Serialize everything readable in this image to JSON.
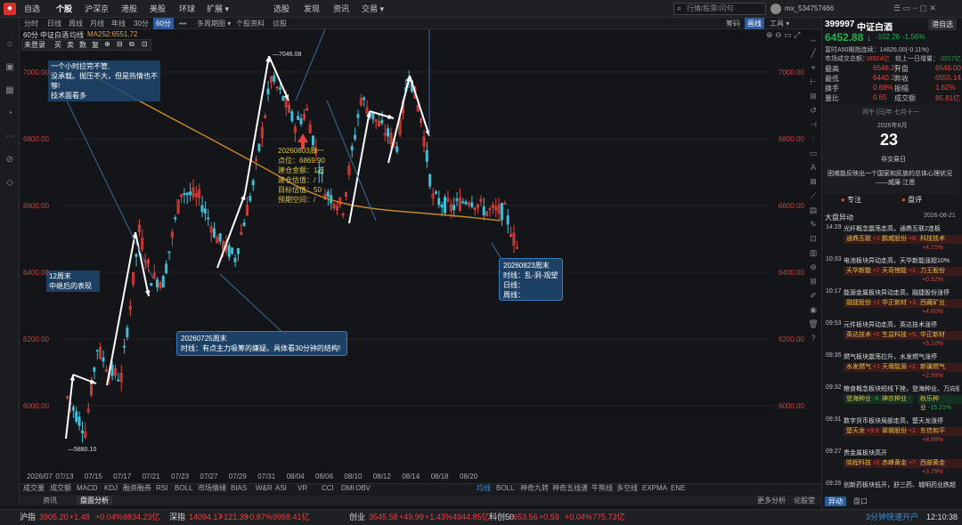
{
  "topbar": {
    "nav": [
      "自选",
      "个股",
      "沪深京",
      "港股",
      "美股",
      "环球",
      "扩展 ▾",
      "选股",
      "发现",
      "资讯",
      "交易 ▾"
    ],
    "active": 1,
    "search_placeholder": "行情/股票/问句",
    "user": "mx_534757466"
  },
  "periodbar": {
    "tabs": [
      "分时",
      "日线",
      "周线",
      "月线",
      "年线",
      "30分",
      "60分",
      "•••",
      "多周期图 ▾",
      "个股资料",
      "诊股"
    ],
    "active": 6,
    "right": [
      "筹码",
      "画线",
      "工具 ▾"
    ]
  },
  "chart": {
    "label": "60分",
    "name": "中证白酒",
    "ma_label": "均线",
    "ma_value": "MA252:6551.72",
    "toolbar": [
      "买",
      "卖",
      "数",
      "复",
      "⊕",
      "⊟",
      "⧉",
      "⊡"
    ],
    "toolbar_first": "未登录",
    "ylabels": [
      "7000.00",
      "6800.00",
      "6600.00",
      "6400.00",
      "6200.00",
      "6000.00"
    ],
    "xlabels": [
      "2026/07",
      "07/13",
      "07/15",
      "07/17",
      "07/21",
      "07/23",
      "07/27",
      "07/29",
      "07/31",
      "08/04",
      "08/06",
      "08/10",
      "08/12",
      "08/14",
      "08/18",
      "08/20"
    ],
    "high_label": "—7046.08",
    "low_label": "—5880.10",
    "notes": {
      "tl1": "一个小时拉完不管,",
      "tl2": "没承载。抛压不大，但是热情也不够!",
      "tl3": "技术面看多",
      "ml1": "12周末",
      "ml2": "中继后的表现",
      "buy1": "20260803周一",
      "buy2": "点位：6869.90",
      "buy3": "建仓金额：1万",
      "buy4": "建仓估值：/",
      "buy5": "目标估值：50",
      "buy6": "预期空间：/",
      "w1": "20260725周末",
      "w2": "时线：有点主力吸筹的嫌疑。具体看30分钟的结构!",
      "r1": "20260823周末",
      "r2": "时线：乱-洞-观望",
      "r3": "日线：",
      "r4": "周线："
    }
  },
  "indicators": {
    "left": [
      "成交量",
      "成交额",
      "MACD",
      "KDJ",
      "融资融券",
      "RSI",
      "BOLL",
      "市场情绪",
      "BIAS",
      "W&R",
      "ASI",
      "VR",
      "CCI",
      "DMI",
      "OBV"
    ],
    "right": [
      "均线",
      "BOLL",
      "神奇九转",
      "神奇五线谱",
      "牛熊线",
      "多空线",
      "EXPMA",
      "ENE"
    ]
  },
  "infobar": {
    "tabs": [
      "资讯",
      "盘面分析"
    ],
    "right": [
      "更多分析",
      "论股堂"
    ]
  },
  "right_panel": {
    "code": "399997",
    "name": "中证白酒",
    "btn": "港自选",
    "price": "6452.88 ↓",
    "chg": "-102.26",
    "pct": "-1.56%",
    "sub1": "富时A50期指连续：14826.00(-0.11%)",
    "sub2a": "市场成交总额：",
    "sub2b": "18924亿",
    "sub2c": "较上一日增量：",
    "sub2d": "-2017亿",
    "stats": [
      [
        "最高",
        "6546.25",
        "开盘",
        "6546.00"
      ],
      [
        "最低",
        "6440.21",
        "昨收",
        "6555.14"
      ],
      [
        "换手",
        "0.68%",
        "振幅",
        "1.62%"
      ],
      [
        "量比",
        "0.65",
        "成交额",
        "85.81亿"
      ]
    ],
    "cal_top": "丙午 [马]年 七月十一",
    "cal_month": "2026年8月",
    "cal_day": "23",
    "cal_note": "非交易日",
    "quote1": "困难能反映出一个国家和民族的总体心理状况",
    "quote2": "——威廉·江恩",
    "btn1": "专注",
    "btn2": "盘评",
    "news_title": "大盘异动",
    "news_date": "2026-08-21",
    "news": [
      {
        "t": "14:29",
        "h": "光纤概念震荡走高，通鼎互联2连板",
        "tags": [
          [
            "通鼎互联",
            "+10.02%",
            "r"
          ],
          [
            "鹏威股份",
            "+8.42%",
            "r"
          ],
          [
            "科技技术",
            "+4.15%",
            "r"
          ]
        ]
      },
      {
        "t": "10:33",
        "h": "电池板块异动走高，天华新能涨超10%",
        "tags": [
          [
            "天华新能",
            "+7.88%",
            "r"
          ],
          [
            "天奇锂能",
            "+1.57%",
            "r"
          ],
          [
            "力王股份",
            "+0.52%",
            "r"
          ]
        ]
      },
      {
        "t": "10:17",
        "h": "能源金属板块异动走高，融捷股份涨停",
        "tags": [
          [
            "融捷股份",
            "+10.00%",
            "r"
          ],
          [
            "华正新材",
            "+3.90%",
            "r"
          ],
          [
            "西藏矿业",
            "+4.60%",
            "r"
          ]
        ]
      },
      {
        "t": "09:53",
        "h": "元件板块异动走高，英达技术涨停",
        "tags": [
          [
            "英达技术",
            "+6.88%",
            "r"
          ],
          [
            "生益科技",
            "+5.16%",
            "r"
          ],
          [
            "华正新材",
            "+5.10%",
            "r"
          ]
        ]
      },
      {
        "t": "09:35",
        "h": "燃气板块震荡拉升，水发燃气涨停",
        "tags": [
          [
            "水发燃气",
            "+10.03%",
            "r"
          ],
          [
            "天壕能源",
            "+2.25%",
            "r"
          ],
          [
            "新疆燃气",
            "+2.99%",
            "r"
          ]
        ]
      },
      {
        "t": "09:32",
        "h": "粮食概念板块短线下挫，登海种业、万向德农跌",
        "tags": [
          [
            "登海种业",
            "-9.04%",
            "g"
          ],
          [
            "神农种业",
            "-",
            "g"
          ],
          [
            "秋乐种业",
            "-15.21%",
            "g"
          ]
        ]
      },
      {
        "t": "09:31",
        "h": "数字货币板块局部走高，楚天龙涨停",
        "tags": [
          [
            "楚天龙",
            "+9.97%",
            "r"
          ],
          [
            "翠微股份",
            "+2.49%",
            "r"
          ],
          [
            "东信和平",
            "+8.99%",
            "r"
          ]
        ]
      },
      {
        "t": "09:27",
        "h": "贵金属板块高开",
        "tags": [
          [
            "晓程科技",
            "+8.55%",
            "r"
          ],
          [
            "赤峰黄金",
            "+7.22%",
            "r"
          ],
          [
            "西部黄金",
            "+3.79%",
            "r"
          ]
        ]
      },
      {
        "t": "09:26",
        "h": "创新药板块低开，舒三药、城明药业跌超",
        "tags": []
      }
    ],
    "tabs": [
      "异动",
      "盘口"
    ],
    "timer": "3分钟快速开户",
    "clock": "12:10:38"
  },
  "ticker": [
    {
      "name": "沪指",
      "val": "3905.20",
      "chg": "+1.48",
      "pct": "+0.04%",
      "amt": "8834.23亿"
    },
    {
      "name": "深指",
      "val": "14094.17",
      "chg": "+121.39",
      "pct": "+0.87%",
      "amt": "9958.41亿"
    },
    {
      "name": "创业",
      "val": "3545.58",
      "chg": "+49.99",
      "pct": "+1.43%",
      "amt": "4944.85亿"
    },
    {
      "name": "科创50",
      "val": "1653.56",
      "chg": "+0.59",
      "pct": "+0.04%",
      "amt": "775.73亿"
    }
  ]
}
